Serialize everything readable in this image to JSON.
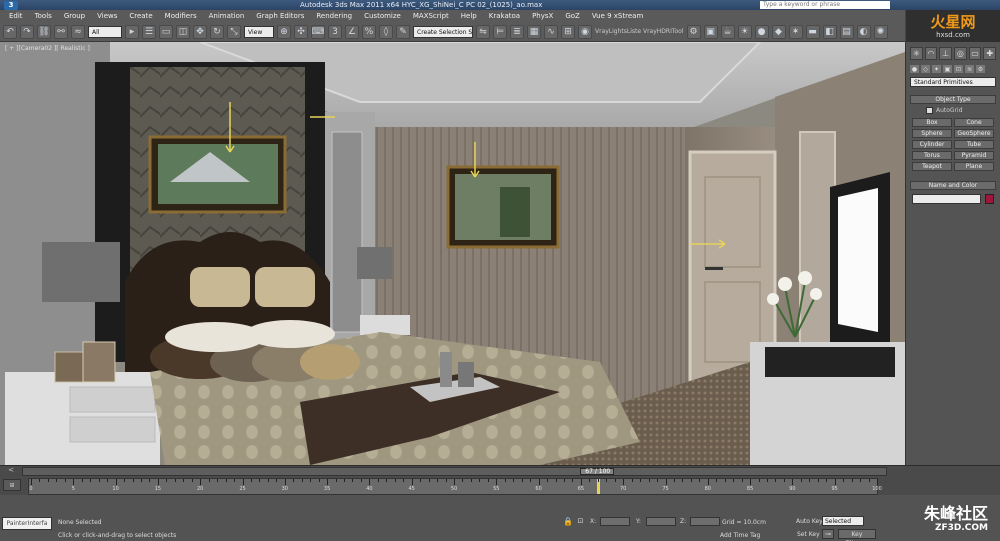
{
  "window": {
    "title": "Autodesk 3ds Max   2011 x64      HYC_XG_ShiNei_C PC 02_(1025)_ao.max",
    "search_placeholder": "Type a keyword or phrase"
  },
  "menu": [
    "Edit",
    "Tools",
    "Group",
    "Views",
    "Create",
    "Modifiers",
    "Animation",
    "Graph Editors",
    "Rendering",
    "Customize",
    "MAXScript",
    "Help",
    "Krakatoa",
    "PhysX",
    "GoZ",
    "Vue 9 xStream"
  ],
  "toolbar": {
    "filter_select": "All",
    "coord_select": "View",
    "selection_set": "Create Selection Se",
    "vray_text": "VrayLightsListe VrayHDRITool"
  },
  "brand": {
    "cn": "火星网",
    "url": "hxsd.com"
  },
  "viewport": {
    "label": "[ + ][Camera02 ][ Realistic ]"
  },
  "command_panel": {
    "category": "Standard Primitives",
    "object_type_title": "Object Type",
    "autogrid_label": "AutoGrid",
    "buttons": [
      "Box",
      "Cone",
      "Sphere",
      "GeoSphere",
      "Cylinder",
      "Tube",
      "Torus",
      "Pyramid",
      "Teapot",
      "Plane"
    ],
    "name_color_title": "Name and Color",
    "object_color": "#a0153c"
  },
  "timeline": {
    "frame_counter": "67 / 100",
    "ticks": [
      "0",
      "5",
      "10",
      "15",
      "20",
      "25",
      "30",
      "35",
      "40",
      "45",
      "50",
      "55",
      "60",
      "65",
      "70",
      "75",
      "80",
      "85",
      "90",
      "95",
      "100"
    ],
    "current_frame": 67,
    "total_frames": 100
  },
  "status": {
    "maxscript_label": "PainterInterfa",
    "selection": "None Selected",
    "prompt": "Click or click-and-drag to select objects",
    "x_label": "X:",
    "y_label": "Y:",
    "z_label": "Z:",
    "grid": "Grid = 10.0cm",
    "add_time_tag": "Add Time Tag",
    "auto_key": "Auto Key",
    "selected_option": "Selected",
    "set_key": "Set Key",
    "key_filters": "Key Filters..."
  },
  "watermark": {
    "cn": "朱峰社区",
    "url": "ZF3D.COM"
  }
}
